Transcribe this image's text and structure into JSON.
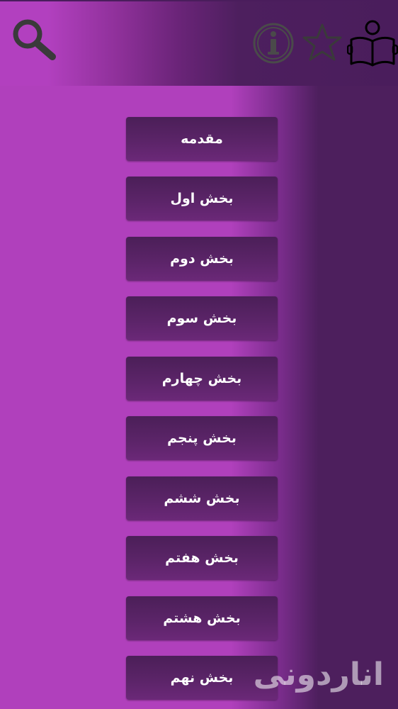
{
  "header": {
    "icons": [
      "search-icon",
      "info-icon",
      "star-icon",
      "book-reader-icon"
    ]
  },
  "menu": {
    "items": [
      {
        "label": "مقدمه"
      },
      {
        "label": "بخش اول"
      },
      {
        "label": "بخش دوم"
      },
      {
        "label": "بخش سوم"
      },
      {
        "label": "بخش چهارم"
      },
      {
        "label": "بخش پنجم"
      },
      {
        "label": "بخش ششم"
      },
      {
        "label": "بخش هفتم"
      },
      {
        "label": "بخش هشتم"
      },
      {
        "label": "بخش نهم"
      }
    ]
  },
  "watermark": {
    "text": "انار‌دونی"
  },
  "colors": {
    "background": "#b040bc",
    "button": "#5b2468",
    "header_dark": "#4a1d5c"
  }
}
